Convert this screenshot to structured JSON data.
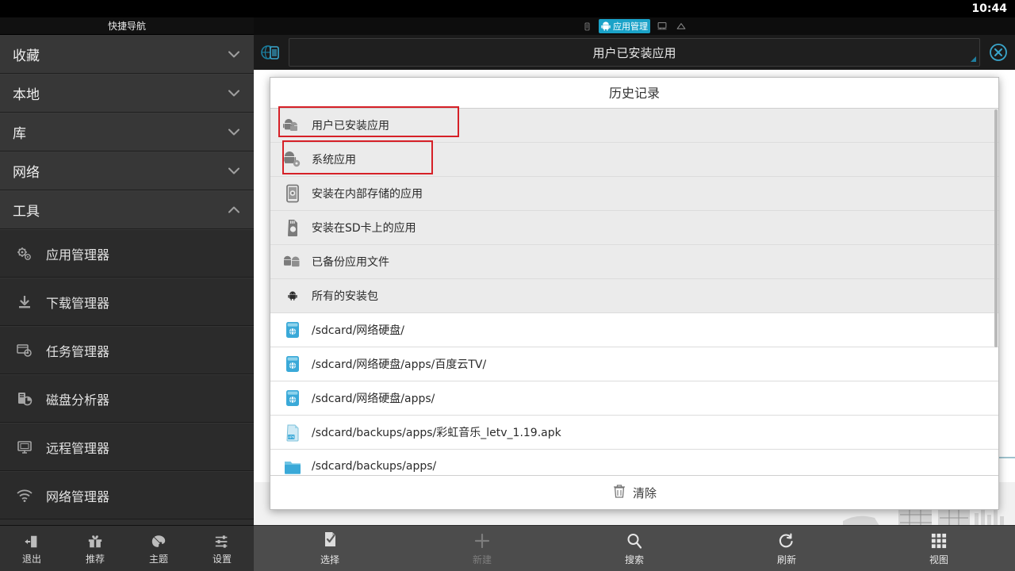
{
  "statusbar": {
    "clock": "10:44"
  },
  "sidebar": {
    "header": "快捷导航",
    "groups": [
      {
        "label": "收藏",
        "chevron": "chevron-down-icon",
        "expanded": false
      },
      {
        "label": "本地",
        "chevron": "chevron-down-icon",
        "expanded": false
      },
      {
        "label": "库",
        "chevron": "chevron-down-icon",
        "expanded": false
      },
      {
        "label": "网络",
        "chevron": "chevron-down-icon",
        "expanded": false
      },
      {
        "label": "工具",
        "chevron": "chevron-up-icon",
        "expanded": true
      }
    ],
    "tools": [
      {
        "label": "应用管理器",
        "icon": "gears-icon"
      },
      {
        "label": "下载管理器",
        "icon": "download-icon"
      },
      {
        "label": "任务管理器",
        "icon": "window-gear-icon"
      },
      {
        "label": "磁盘分析器",
        "icon": "disk-chart-icon"
      },
      {
        "label": "远程管理器",
        "icon": "monitor-icon"
      },
      {
        "label": "网络管理器",
        "icon": "wifi-icon"
      }
    ],
    "bottom_bar": [
      {
        "label": "退出",
        "icon": "exit-icon"
      },
      {
        "label": "推荐",
        "icon": "gift-icon"
      },
      {
        "label": "主题",
        "icon": "palette-icon"
      },
      {
        "label": "设置",
        "icon": "sliders-icon"
      }
    ]
  },
  "main": {
    "tabs": [
      {
        "label": "",
        "icon": "phone-icon",
        "active": false
      },
      {
        "label": "应用管理",
        "icon": "android-icon",
        "active": true
      },
      {
        "label": "",
        "icon": "computer-icon",
        "active": false
      },
      {
        "label": "",
        "icon": "cloud-icon",
        "active": false
      }
    ],
    "titlebar": {
      "left_icon": "globe-device-icon",
      "address_value": "用户已安装应用",
      "close_icon": "close-circle-icon"
    },
    "bottom_bar": [
      {
        "label": "选择",
        "icon": "select-check-icon",
        "disabled": false
      },
      {
        "label": "新建",
        "icon": "plus-icon",
        "disabled": true
      },
      {
        "label": "搜索",
        "icon": "search-icon",
        "disabled": false
      },
      {
        "label": "刷新",
        "icon": "refresh-icon",
        "disabled": false
      },
      {
        "label": "视图",
        "icon": "grid-view-icon",
        "disabled": false
      }
    ]
  },
  "dialog": {
    "title": "历史记录",
    "rows": [
      {
        "label": "用户已安装应用",
        "icon": "android-apps-icon",
        "style": "shaded",
        "annotated": true
      },
      {
        "label": "系统应用",
        "icon": "android-gear-icon",
        "style": "shaded",
        "annotated": true
      },
      {
        "label": "安装在内部存储的应用",
        "icon": "phone-storage-icon",
        "style": "shaded",
        "annotated": false
      },
      {
        "label": "安装在SD卡上的应用",
        "icon": "sdcard-icon",
        "style": "shaded",
        "annotated": false
      },
      {
        "label": "已备份应用文件",
        "icon": "android-double-icon",
        "style": "shaded",
        "annotated": false
      },
      {
        "label": "所有的安装包",
        "icon": "android-icon",
        "style": "shaded",
        "annotated": false
      },
      {
        "label": "/sdcard/网络硬盘/",
        "icon": "netdisk-folder-icon",
        "style": "plain",
        "annotated": false
      },
      {
        "label": "/sdcard/网络硬盘/apps/百度云TV/",
        "icon": "netdisk-folder-icon",
        "style": "plain",
        "annotated": false
      },
      {
        "label": "/sdcard/网络硬盘/apps/",
        "icon": "netdisk-folder-icon",
        "style": "plain",
        "annotated": false
      },
      {
        "label": "/sdcard/backups/apps/彩虹音乐_letv_1.19.apk",
        "icon": "apk-file-icon",
        "style": "plain",
        "annotated": false
      },
      {
        "label": "/sdcard/backups/apps/",
        "icon": "folder-icon",
        "style": "plain",
        "annotated": false
      }
    ],
    "footer": {
      "label": "清除",
      "icon": "trash-icon"
    }
  },
  "colors": {
    "accent_cyan": "#1aa2c8",
    "annotation_red": "#d62027",
    "sidebar_bg": "#2e2e2e",
    "dialog_bg": "#ffffff",
    "row_shaded": "#ebebeb"
  }
}
